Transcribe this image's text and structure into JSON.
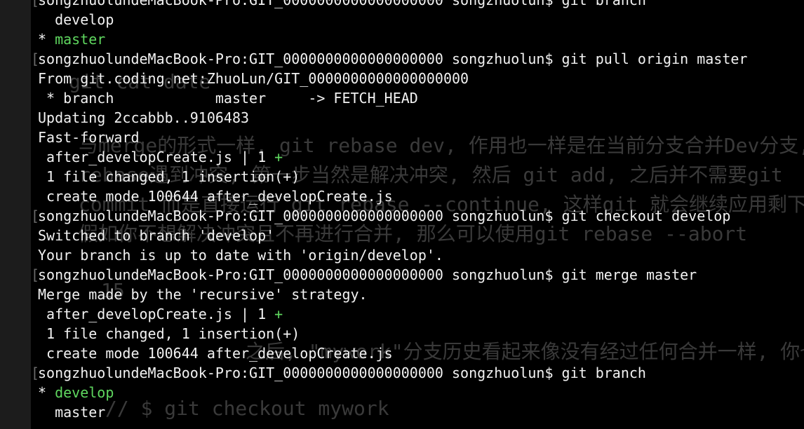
{
  "terminal": {
    "lines": [
      {
        "type": "prompt",
        "prompt": "songzhuolundeMacBook-Pro:GIT_0000000000000000000 songzhuolun$ ",
        "command": "git branch"
      },
      {
        "type": "out",
        "text": "  develop"
      },
      {
        "type": "star",
        "marker": "* ",
        "text": "master"
      },
      {
        "type": "prompt",
        "prompt": "songzhuolundeMacBook-Pro:GIT_0000000000000000000 songzhuolun$ ",
        "command": "git pull origin master"
      },
      {
        "type": "out",
        "text": "From git.coding.net:ZhuoLun/GIT_0000000000000000000"
      },
      {
        "type": "out",
        "text": " * branch            master     -> FETCH_HEAD"
      },
      {
        "type": "out",
        "text": "Updating 2ccabbb..9106483"
      },
      {
        "type": "out",
        "text": "Fast-forward"
      },
      {
        "type": "stat",
        "text": " after_developCreate.js | 1 ",
        "plus": "+"
      },
      {
        "type": "out",
        "text": " 1 file changed, 1 insertion(+)"
      },
      {
        "type": "out",
        "text": " create mode 100644 after_developCreate.js"
      },
      {
        "type": "prompt",
        "prompt": "songzhuolundeMacBook-Pro:GIT_0000000000000000000 songzhuolun$ ",
        "command": "git checkout develop"
      },
      {
        "type": "out",
        "text": "Switched to branch 'develop'"
      },
      {
        "type": "out",
        "text": "Your branch is up to date with 'origin/develop'."
      },
      {
        "type": "prompt",
        "prompt": "songzhuolundeMacBook-Pro:GIT_0000000000000000000 songzhuolun$ ",
        "command": "git merge master"
      },
      {
        "type": "out",
        "text": "Merge made by the 'recursive' strategy."
      },
      {
        "type": "stat",
        "text": " after_developCreate.js | 1 ",
        "plus": "+"
      },
      {
        "type": "out",
        "text": " 1 file changed, 1 insertion(+)"
      },
      {
        "type": "out",
        "text": " create mode 100644 after_developCreate.js"
      },
      {
        "type": "prompt",
        "prompt": "songzhuolundeMacBook-Pro:GIT_0000000000000000000 songzhuolun$ ",
        "command": "git branch"
      },
      {
        "type": "star",
        "marker": "* ",
        "text": "develop"
      },
      {
        "type": "out",
        "text": "  master"
      }
    ]
  },
  "background_text": [
    "git cat date",
    "与merge的形式一样, git rebase dev, 作用也一样是在当前分支合并Dev分支, 如",
    "rebase遇到冲突, 第一步当然是解决冲突, 然后 git add, 之后并不需要git",
    "commit 而是直接运行 git rebase --continue, 这样git 就会继续应用剩下的补",
    "假如你不想解决冲突且不再进行合并, 那么可以使用git rebase --abort",
    "15",
    "之后, \"mywork\"分支历史看起来像没有经过任何合并一样, 你也",
    "// $ git checkout mywork"
  ],
  "colors": {
    "background": "#000000",
    "foreground": "#f2f2f2",
    "branch_green": "#5fd75f",
    "ghost_text": "#3a3a3a"
  }
}
